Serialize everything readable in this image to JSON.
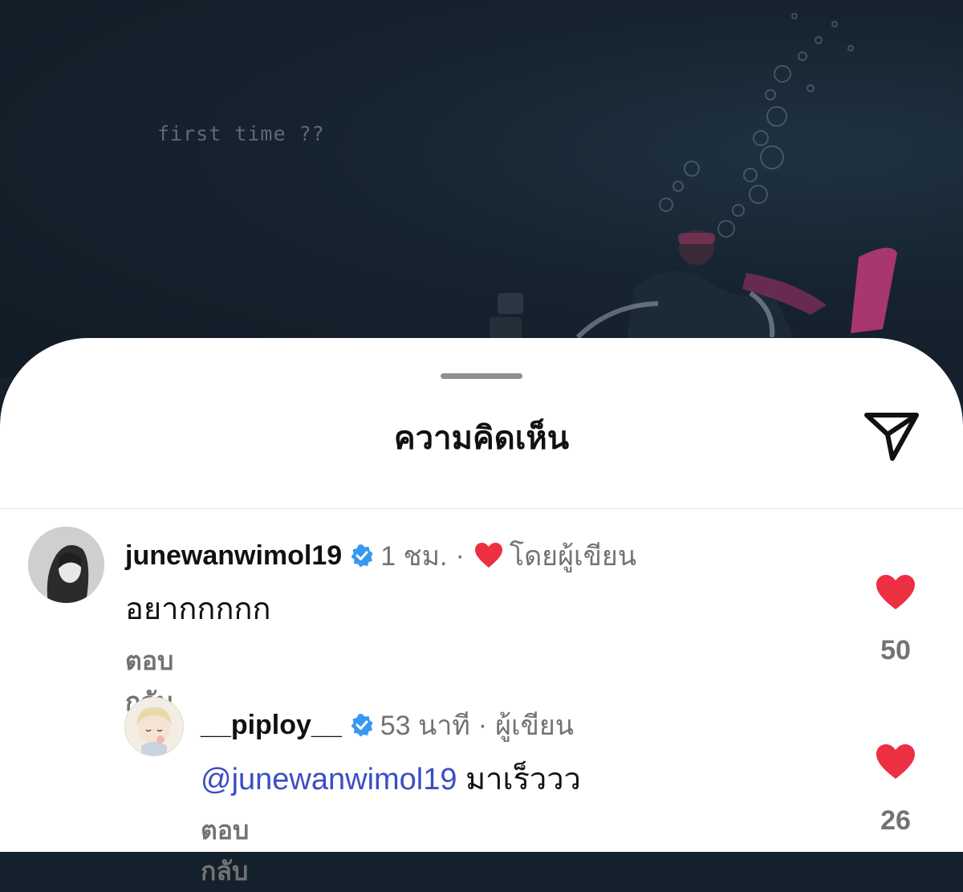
{
  "post": {
    "caption": "first time ??"
  },
  "sheet": {
    "title": "ความคิดเห็น"
  },
  "comments": [
    {
      "username": "junewanwimol19",
      "time": "1 ชม.",
      "by_author_label": "โดยผู้เขียน",
      "text": "อยากกกกก",
      "reply_label": "ตอบกลับ",
      "likes": "50"
    }
  ],
  "replies": [
    {
      "username": "__piploy__",
      "time": "53 นาที",
      "author_label": "ผู้เขียน",
      "mention": "@junewanwimol19",
      "text": "มาเร็ววว",
      "reply_label": "ตอบกลับ",
      "likes": "26"
    }
  ],
  "colors": {
    "like_red": "#ed2f42",
    "verified_blue": "#3897f0",
    "mention_blue": "#3b4ec4"
  }
}
